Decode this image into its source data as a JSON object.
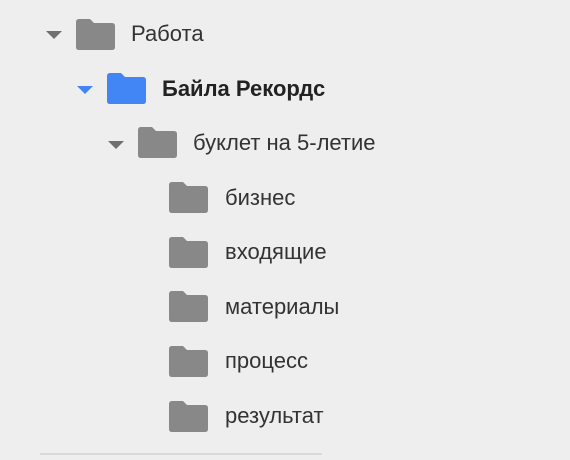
{
  "folder_tree": {
    "items": [
      {
        "label": "Работа",
        "expanded": true,
        "selected": false,
        "has_caret": true
      },
      {
        "label": "Байла Рекордс",
        "expanded": true,
        "selected": true,
        "has_caret": true
      },
      {
        "label": "буклет на 5-летие",
        "expanded": true,
        "selected": false,
        "has_caret": true
      },
      {
        "label": "бизнес",
        "expanded": false,
        "selected": false,
        "has_caret": false
      },
      {
        "label": "входящие",
        "expanded": false,
        "selected": false,
        "has_caret": false
      },
      {
        "label": "материалы",
        "expanded": false,
        "selected": false,
        "has_caret": false
      },
      {
        "label": "процесс",
        "expanded": false,
        "selected": false,
        "has_caret": false
      },
      {
        "label": "результат",
        "expanded": false,
        "selected": false,
        "has_caret": false
      }
    ]
  },
  "colors": {
    "folder_default": "#888888",
    "folder_selected": "#4285f4",
    "caret_default": "#6f6f6f",
    "caret_selected": "#4285f4",
    "background": "#eeeeee"
  }
}
